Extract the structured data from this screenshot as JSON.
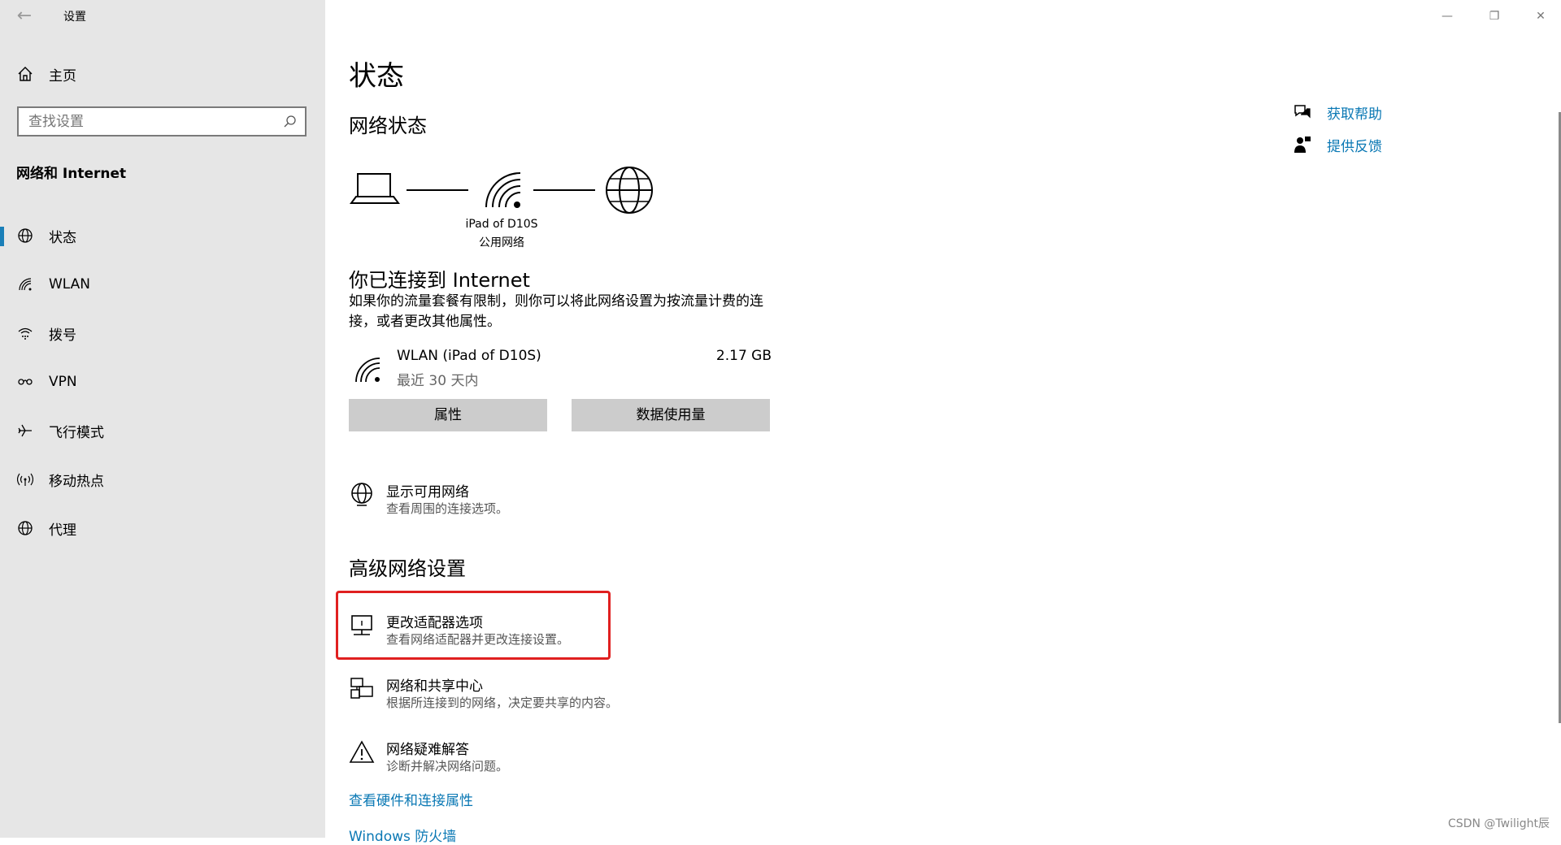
{
  "app": {
    "back_glyph": "←",
    "title": "设置"
  },
  "window_controls": {
    "minimize": "—",
    "maximize": "❐",
    "close": "✕"
  },
  "sidebar": {
    "home": {
      "label": "主页",
      "icon": "home-icon"
    },
    "search": {
      "placeholder": "查找设置",
      "value": ""
    },
    "section_title": "网络和 Internet",
    "items": [
      {
        "label": "状态",
        "icon": "globe-status-icon",
        "active": true
      },
      {
        "label": "WLAN",
        "icon": "wifi-icon",
        "active": false
      },
      {
        "label": "拨号",
        "icon": "dialup-icon",
        "active": false
      },
      {
        "label": "VPN",
        "icon": "vpn-icon",
        "active": false
      },
      {
        "label": "飞行模式",
        "icon": "airplane-icon",
        "active": false
      },
      {
        "label": "移动热点",
        "icon": "hotspot-icon",
        "active": false
      },
      {
        "label": "代理",
        "icon": "proxy-globe-icon",
        "active": false
      }
    ]
  },
  "main": {
    "title": "状态",
    "network_status_heading": "网络状态",
    "diagram": {
      "ssid": "iPad of D10S",
      "network_type": "公用网络"
    },
    "connected_title": "你已连接到 Internet",
    "connected_desc": "如果你的流量套餐有限制，则你可以将此网络设置为按流量计费的连接，或者更改其他属性。",
    "wlan": {
      "name": "WLAN (iPad of D10S)",
      "period": "最近 30 天内",
      "usage": "2.17 GB"
    },
    "buttons": {
      "properties": "属性",
      "data_usage": "数据使用量"
    },
    "show_networks": {
      "title": "显示可用网络",
      "subtitle": "查看周围的连接选项。"
    },
    "advanced_heading": "高级网络设置",
    "adapter": {
      "title": "更改适配器选项",
      "subtitle": "查看网络适配器并更改连接设置。"
    },
    "sharing": {
      "title": "网络和共享中心",
      "subtitle": "根据所连接到的网络，决定要共享的内容。"
    },
    "troubleshoot": {
      "title": "网络疑难解答",
      "subtitle": "诊断并解决网络问题。"
    },
    "hardware_link": "查看硬件和连接属性",
    "firewall_link": "Windows 防火墙"
  },
  "help": {
    "get_help": "获取帮助",
    "feedback": "提供反馈"
  },
  "watermark": "CSDN @Twilight辰",
  "colors": {
    "accent": "#0a78b4",
    "sidebar_bg": "#e6e6e6",
    "highlight": "#e02020",
    "button_bg": "#cccccc"
  }
}
